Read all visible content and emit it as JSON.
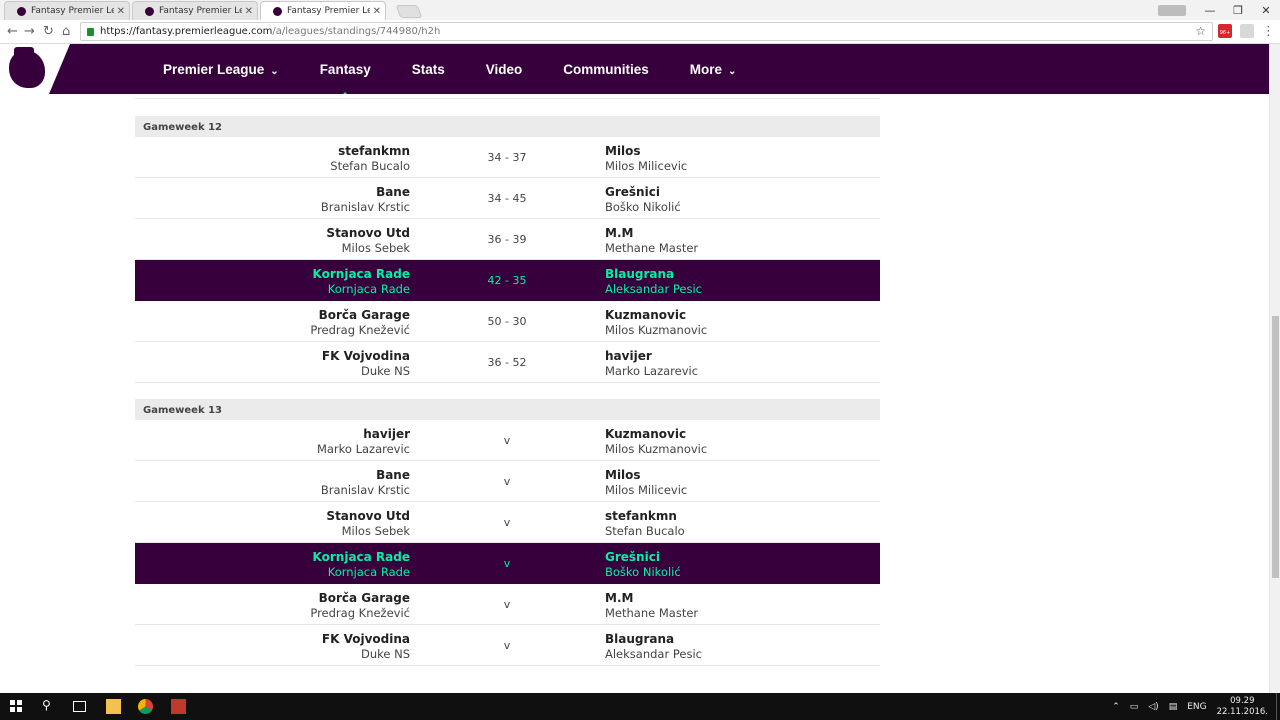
{
  "browser": {
    "tabs": [
      {
        "title": "Fantasy Premier League"
      },
      {
        "title": "Fantasy Premier League"
      },
      {
        "title": "Fantasy Premier League"
      }
    ],
    "url_host": "https://fantasy.premierleague.com",
    "url_path": "/a/leagues/standings/744980/h2h",
    "ext_badge": "96+"
  },
  "nav": {
    "items": [
      {
        "label": "Premier League",
        "dropdown": true
      },
      {
        "label": "Fantasy",
        "active": true
      },
      {
        "label": "Stats"
      },
      {
        "label": "Video"
      },
      {
        "label": "Communities"
      },
      {
        "label": "More",
        "dropdown": true
      }
    ],
    "chevron": "⌄"
  },
  "gameweeks": [
    {
      "title": "Gameweek 12",
      "fixtures": [
        {
          "home_team": "stefankmn",
          "home_manager": "Stefan Bucalo",
          "score": "34 - 37",
          "away_team": "Milos",
          "away_manager": "Milos Milicevic"
        },
        {
          "home_team": "Bane",
          "home_manager": "Branislav Krstic",
          "score": "34 - 45",
          "away_team": "Grešnici",
          "away_manager": "Boško Nikolić"
        },
        {
          "home_team": "Stanovo Utd",
          "home_manager": "Milos Sebek",
          "score": "36 - 39",
          "away_team": "M.M",
          "away_manager": "Methane Master"
        },
        {
          "home_team": "Kornjaca Rade",
          "home_manager": "Kornjaca Rade",
          "score": "42 - 35",
          "away_team": "Blaugrana",
          "away_manager": "Aleksandar Pesic",
          "highlight": true
        },
        {
          "home_team": "Borča Garage",
          "home_manager": "Predrag Knežević",
          "score": "50 - 30",
          "away_team": "Kuzmanovic",
          "away_manager": "Milos Kuzmanovic"
        },
        {
          "home_team": "FK Vojvodina",
          "home_manager": "Duke NS",
          "score": "36 - 52",
          "away_team": "havijer",
          "away_manager": "Marko Lazarevic"
        }
      ]
    },
    {
      "title": "Gameweek 13",
      "fixtures": [
        {
          "home_team": "havijer",
          "home_manager": "Marko Lazarevic",
          "score": "v",
          "away_team": "Kuzmanovic",
          "away_manager": "Milos Kuzmanovic"
        },
        {
          "home_team": "Bane",
          "home_manager": "Branislav Krstic",
          "score": "v",
          "away_team": "Milos",
          "away_manager": "Milos Milicevic"
        },
        {
          "home_team": "Stanovo Utd",
          "home_manager": "Milos Sebek",
          "score": "v",
          "away_team": "stefankmn",
          "away_manager": "Stefan Bucalo"
        },
        {
          "home_team": "Kornjaca Rade",
          "home_manager": "Kornjaca Rade",
          "score": "v",
          "away_team": "Grešnici",
          "away_manager": "Boško Nikolić",
          "highlight": true
        },
        {
          "home_team": "Borča Garage",
          "home_manager": "Predrag Knežević",
          "score": "v",
          "away_team": "M.M",
          "away_manager": "Methane Master"
        },
        {
          "home_team": "FK Vojvodina",
          "home_manager": "Duke NS",
          "score": "v",
          "away_team": "Blaugrana",
          "away_manager": "Aleksandar Pesic"
        }
      ]
    }
  ],
  "taskbar": {
    "lang": "ENG",
    "time": "09.29",
    "date": "22.11.2016."
  },
  "colors": {
    "brand": "#37003c",
    "accent": "#00ff87"
  }
}
